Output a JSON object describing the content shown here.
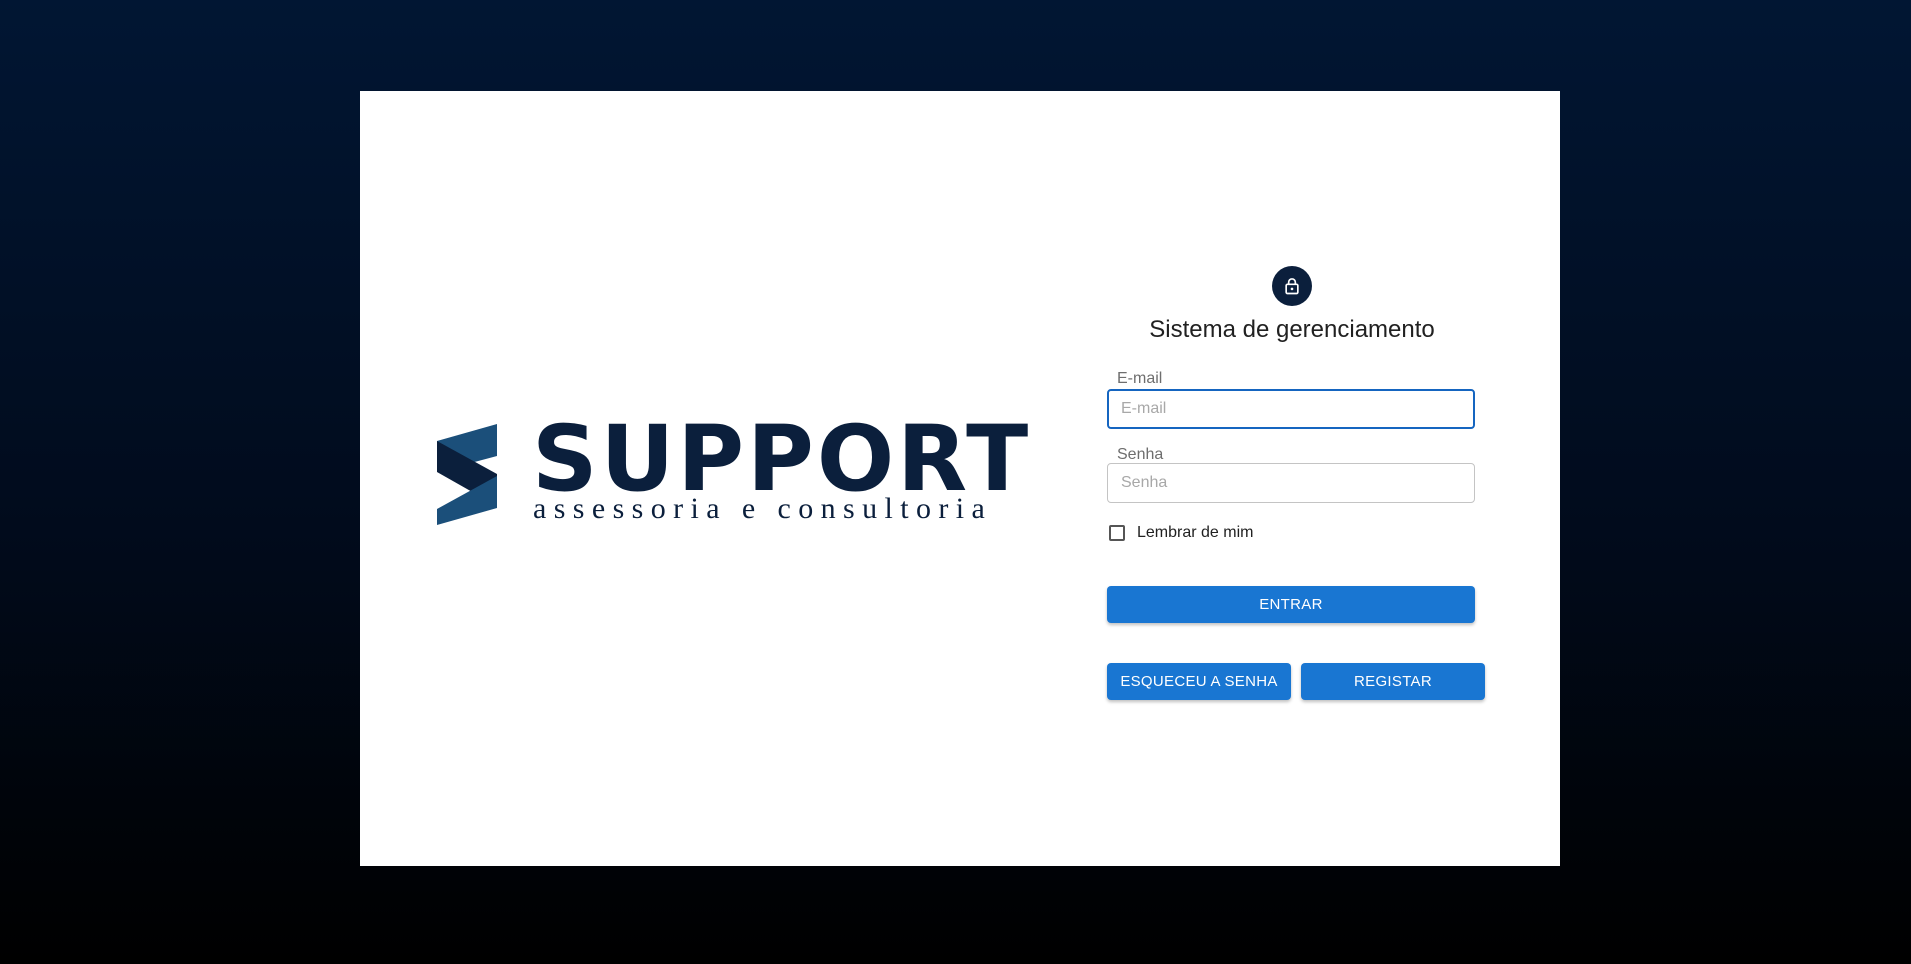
{
  "logo": {
    "wordmark": "SUPPORT",
    "tagline": "assessoria e consultoria"
  },
  "form": {
    "icon": "lock-icon",
    "title": "Sistema de gerenciamento",
    "email": {
      "label": "E-mail",
      "placeholder": "E-mail",
      "value": ""
    },
    "password": {
      "label": "Senha",
      "placeholder": "Senha",
      "value": ""
    },
    "remember": {
      "label": "Lembrar de mim",
      "checked": false
    },
    "buttons": {
      "submit": "ENTRAR",
      "forgot": "ESQUECEU A SENHA",
      "register": "REGISTAR"
    }
  },
  "colors": {
    "background_top": "#011633",
    "background_bottom": "#000000",
    "brand_navy": "#0b1f3c",
    "primary_button": "#1976d2",
    "focus_border": "#1565c0"
  }
}
